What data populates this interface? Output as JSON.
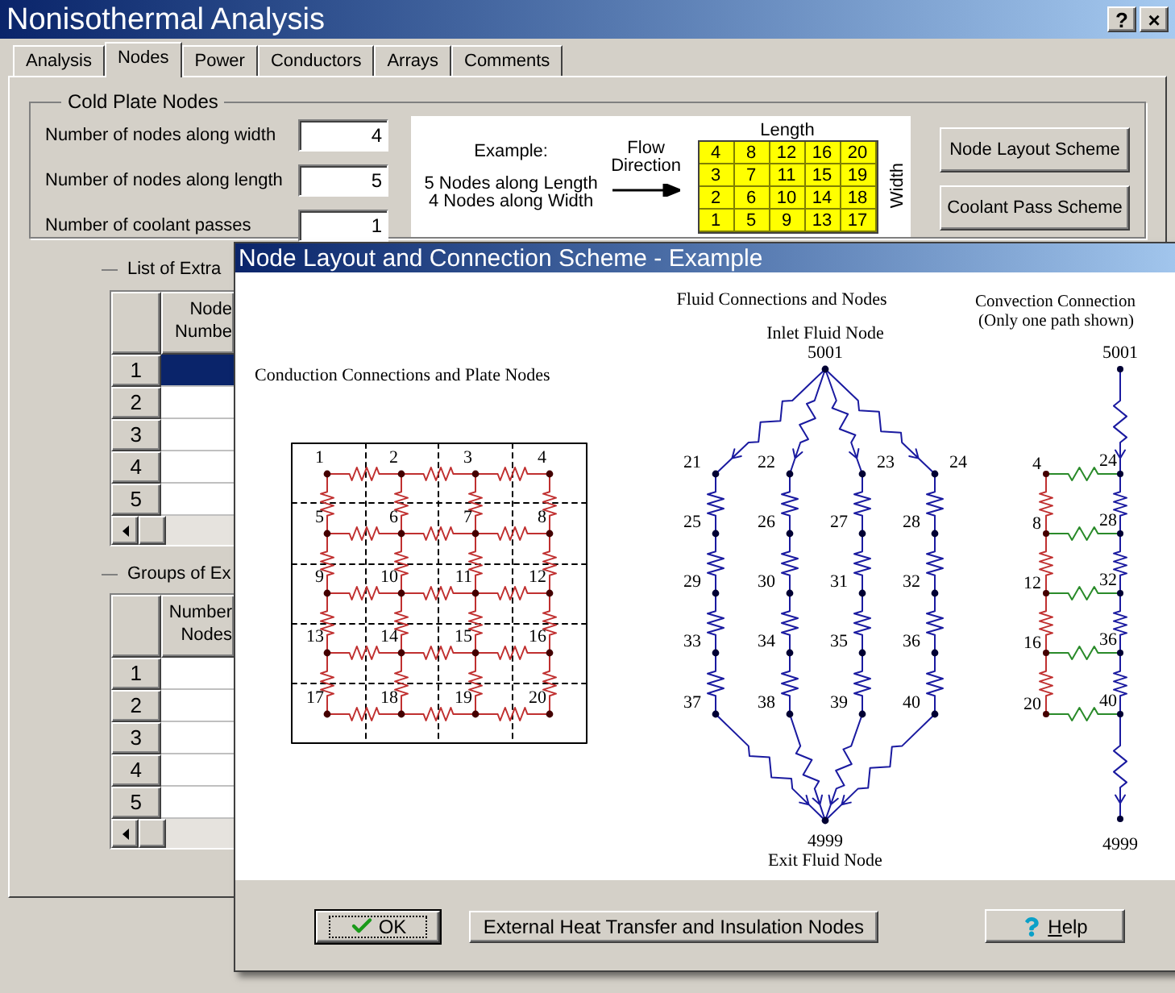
{
  "window": {
    "title": "Nonisothermal Analysis",
    "title_buttons": [
      "?",
      "×"
    ]
  },
  "tabs": [
    {
      "label": "Analysis",
      "selected": false
    },
    {
      "label": "Nodes",
      "selected": true
    },
    {
      "label": "Power",
      "selected": false
    },
    {
      "label": "Conductors",
      "selected": false
    },
    {
      "label": "Arrays",
      "selected": false
    },
    {
      "label": "Comments",
      "selected": false
    }
  ],
  "cold_plate": {
    "title": "Cold Plate Nodes",
    "fields": [
      {
        "label": "Number of nodes along width",
        "value": "4"
      },
      {
        "label": "Number of nodes along length",
        "value": "5"
      },
      {
        "label": "Number of coolant passes",
        "value": "1"
      }
    ],
    "example": {
      "caption": "Example:",
      "lines": [
        "5 Nodes along Length",
        "4 Nodes along Width"
      ],
      "flow_label": [
        "Flow",
        "Direction"
      ],
      "length_label": "Length",
      "width_label": "Width",
      "grid": [
        [
          "4",
          "8",
          "12",
          "16",
          "20"
        ],
        [
          "3",
          "7",
          "11",
          "15",
          "19"
        ],
        [
          "2",
          "6",
          "10",
          "14",
          "18"
        ],
        [
          "1",
          "5",
          "9",
          "13",
          "17"
        ]
      ]
    },
    "buttons": [
      "Node Layout Scheme",
      "Coolant Pass Scheme"
    ]
  },
  "extra_nodes": {
    "title": "List of Extra",
    "column": [
      "Node",
      "Numbe"
    ],
    "rows": [
      {
        "label": "1",
        "selected": true
      },
      {
        "label": "2",
        "selected": false
      },
      {
        "label": "3",
        "selected": false
      },
      {
        "label": "4",
        "selected": false
      },
      {
        "label": "5",
        "selected": false
      }
    ]
  },
  "groups": {
    "title": "Groups of Ex",
    "column": [
      "Number",
      "Nodes"
    ],
    "rows": [
      {
        "label": "1",
        "selected": false
      },
      {
        "label": "2",
        "selected": false
      },
      {
        "label": "3",
        "selected": false
      },
      {
        "label": "4",
        "selected": false
      },
      {
        "label": "5",
        "selected": false
      }
    ]
  },
  "dialog": {
    "title": "Node Layout and Connection Scheme - Example",
    "conduction": {
      "title": "Conduction Connections and Plate Nodes",
      "nodes": [
        [
          "1",
          "2",
          "3",
          "4"
        ],
        [
          "5",
          "6",
          "7",
          "8"
        ],
        [
          "9",
          "10",
          "11",
          "12"
        ],
        [
          "13",
          "14",
          "15",
          "16"
        ],
        [
          "17",
          "18",
          "19",
          "20"
        ]
      ]
    },
    "fluid": {
      "title": "Fluid Connections and Nodes",
      "inlet_label": "Inlet Fluid Node",
      "inlet_node": "5001",
      "nodes": [
        [
          "21",
          "22",
          "23",
          "24"
        ],
        [
          "25",
          "26",
          "27",
          "28"
        ],
        [
          "29",
          "30",
          "31",
          "32"
        ],
        [
          "33",
          "34",
          "35",
          "36"
        ],
        [
          "37",
          "38",
          "39",
          "40"
        ]
      ],
      "exit_node": "4999",
      "exit_label": "Exit Fluid Node"
    },
    "convection": {
      "title": [
        "Convection Connection",
        "(Only one path shown)"
      ],
      "inlet_node": "5001",
      "plate_nodes": [
        "4",
        "8",
        "12",
        "16",
        "20"
      ],
      "fluid_nodes": [
        "24",
        "28",
        "32",
        "36",
        "40"
      ],
      "exit_node": "4999"
    },
    "buttons": [
      {
        "kind": "ok",
        "label": "OK"
      },
      {
        "kind": "plain",
        "label": "External Heat Transfer and Insulation Nodes"
      },
      {
        "kind": "help",
        "label": "Help"
      }
    ]
  }
}
